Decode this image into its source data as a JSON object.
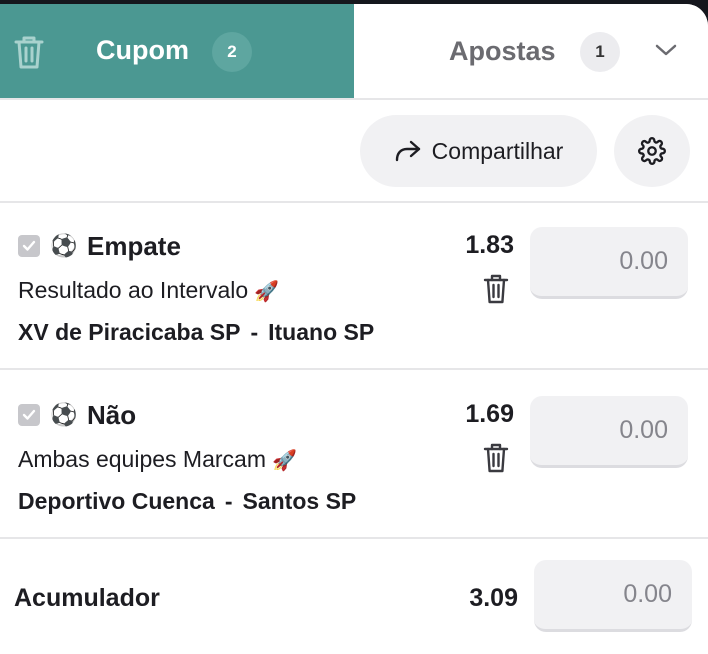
{
  "tabs": {
    "cupom": {
      "label": "Cupom",
      "count": "2"
    },
    "apostas": {
      "label": "Apostas",
      "count": "1"
    }
  },
  "toolbar": {
    "share_label": "Compartilhar"
  },
  "bets": [
    {
      "selection": "Empate",
      "market": "Resultado ao Intervalo",
      "home": "XV de Piracicaba SP",
      "separator": "-",
      "away": "Ituano SP",
      "odds": "1.83",
      "stake_placeholder": "0.00"
    },
    {
      "selection": "Não",
      "market": "Ambas equipes Marcam",
      "home": "Deportivo Cuenca",
      "separator": "-",
      "away": "Santos SP",
      "odds": "1.69",
      "stake_placeholder": "0.00"
    }
  ],
  "accumulator": {
    "label": "Acumulador",
    "odds": "3.09",
    "stake_placeholder": "0.00"
  },
  "colors": {
    "accent": "#4b9892",
    "badge_cupom": "#5ea6a0",
    "field_bg": "#f1f1f3"
  },
  "icons": [
    "trash-icon",
    "chevron-down-icon",
    "share-icon",
    "gear-icon",
    "checkbox-icon",
    "soccer-ball-icon",
    "rocket-icon"
  ]
}
